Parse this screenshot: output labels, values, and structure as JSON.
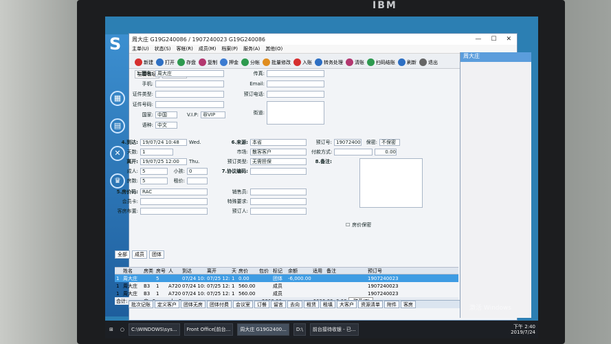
{
  "brand": "IBM",
  "window": {
    "title": "周大庄 G19G240086 / 1907240023 G19G240086",
    "controls": [
      "—",
      "☐",
      "✕"
    ]
  },
  "menu": [
    "主单(U)",
    "状态(S)",
    "客帐(R)",
    "成员(M)",
    "档案(P)",
    "服务(A)",
    "其他(O)"
  ],
  "toolbar": [
    "新建",
    "打开",
    "存盘",
    "复制",
    "押金",
    "分帐",
    "批量修改",
    "入账",
    "转务处理",
    "清账",
    "扫码结账",
    "刷新",
    "退出"
  ],
  "formTabs": [
    "主要信息",
    "附加信息"
  ],
  "fields": {
    "name_label": "1.团名:",
    "name_value": "周大庄",
    "phone_label": "手机:",
    "id_type_label": "证件类型:",
    "id_no_label": "证件号码:",
    "country_label": "国家:",
    "country_value": "中国",
    "vip_label": "V.I.P:",
    "vip_value": "非VIP",
    "language_label": "语种:",
    "language_value": "中文",
    "fax_label": "传真:",
    "email_label": "Email:",
    "booking_phone_label": "预订电话:",
    "address_label": "街道:",
    "arrive_label": "4.到达:",
    "arrive_value": "19/07/24 10:48",
    "arrive_day": "Wed.",
    "days_label": "天数:",
    "days_value": "1",
    "depart_label": "离开:",
    "depart_value": "19/07/25 12:00",
    "depart_day": "Thu.",
    "adult_label": "成人:",
    "adult_value": "5",
    "child_label": "小孩:",
    "child_value": "0",
    "rooms_label": "房数:",
    "rooms_value": "5",
    "bed_label": "租价:",
    "rate_label": "5.房价码:",
    "rate_value": "RAC",
    "card_label": "会员卡:",
    "layout_label": "客房布置:",
    "source_label": "6.来源:",
    "source_value": "本省",
    "market_label": "市场:",
    "market_value": "散客客户",
    "booking_type_label": "预订类型:",
    "booking_type_value": "无需担保",
    "protocol_label": "7.协议编码:",
    "sales_label": "销售员:",
    "special_label": "特殊要求:",
    "booker_label": "预订人:",
    "booking_no_label": "预订号:",
    "booking_no_value": "1907240023",
    "secret_label": "保密:",
    "secret_value": "不保密",
    "pay_label": "付款方式:",
    "pay_value": "0.00",
    "remark_label": "8.备注:",
    "room_secret_label": "房价保密"
  },
  "tableTabs": [
    "全部",
    "成员",
    "团体"
  ],
  "table": {
    "headers": [
      "",
      "姓名",
      "房类",
      "房号",
      "人",
      "到达",
      "离开",
      "天",
      "房价",
      "包价",
      "标记",
      "余额",
      "适用",
      "备注",
      "预订号"
    ],
    "rows": [
      [
        "1",
        "周大庄",
        "",
        "5",
        "",
        "07/24 10:48",
        "07/25 12:00",
        "1",
        "0.00",
        "",
        "团体",
        "-6,000.00",
        "",
        "",
        "1907240023"
      ],
      [
        "1",
        "周大庄",
        "B3",
        "1",
        "A7201",
        "07/24 10:48",
        "07/25 12:00",
        "1",
        "560.00",
        "",
        "成员",
        "",
        "",
        "",
        "1907240023"
      ],
      [
        "1",
        "周大庄",
        "B3",
        "1",
        "A7202",
        "07/24 10:48",
        "07/25 12:00",
        "1",
        "560.00",
        "",
        "成员",
        "",
        "",
        "",
        "1907240023"
      ]
    ],
    "total_label": "合计:",
    "total_rooms": "房=5",
    "total_people": "人=5",
    "total_value": "2800.00",
    "balance_value": "-6000.00",
    "balance_zero": "0.00",
    "search_button": "联系(T)"
  },
  "bottomTabs": [
    "批次记账",
    "定义客户",
    "团体无房",
    "团体付费",
    "会议室",
    "订餐",
    "留言",
    "去向",
    "租赁",
    "租填",
    "大客户",
    "资源清单",
    "附件",
    "客房"
  ],
  "rightPanel": {
    "title": "周大庄"
  },
  "taskbar": {
    "items": [
      "C:\\WINDOWS\\sys...",
      "Front Office[前台...",
      "周大庄 G19G2400...",
      "D:\\",
      "前台接待收银 - 已..."
    ],
    "time": "下午 2:40",
    "date": "2019/7/24"
  },
  "watermark": "激活 Windows"
}
